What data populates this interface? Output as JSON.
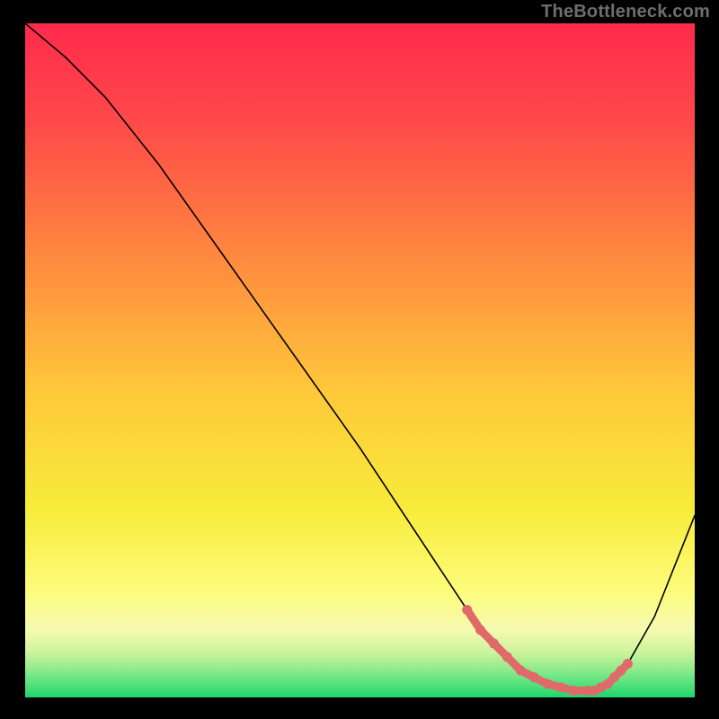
{
  "watermark": "TheBottleneck.com",
  "chart_data": {
    "type": "line",
    "title": "",
    "xlabel": "",
    "ylabel": "",
    "xlim": [
      0,
      100
    ],
    "ylim": [
      0,
      100
    ],
    "grid": false,
    "series": [
      {
        "name": "bottleneck-curve",
        "x": [
          0,
          6,
          12,
          20,
          30,
          40,
          50,
          60,
          66,
          70,
          74,
          78,
          82,
          85,
          87,
          90,
          94,
          100
        ],
        "y": [
          100,
          95,
          89,
          79,
          65,
          51,
          37,
          22,
          13,
          8,
          4,
          2,
          1,
          1,
          2,
          5,
          12,
          27
        ],
        "stroke": "#000000",
        "stroke_width": 1.6
      },
      {
        "name": "optimal-region-markers",
        "x": [
          66,
          68,
          70,
          72,
          74,
          76,
          78,
          80,
          82,
          84,
          85,
          86,
          87,
          88,
          89,
          90
        ],
        "y": [
          13,
          10,
          8,
          6,
          4,
          3,
          2,
          1.5,
          1,
          1,
          1,
          1.5,
          2,
          3,
          4,
          5
        ],
        "stroke": "#e06a6a",
        "marker_color": "#e06a6a",
        "marker_radius": 5.5
      }
    ],
    "background_gradient": {
      "stops": [
        {
          "offset": 0.0,
          "color": "#ff2a4d"
        },
        {
          "offset": 0.15,
          "color": "#ff4a49"
        },
        {
          "offset": 0.35,
          "color": "#ff8a3f"
        },
        {
          "offset": 0.55,
          "color": "#ffc93a"
        },
        {
          "offset": 0.72,
          "color": "#f7ec3a"
        },
        {
          "offset": 0.84,
          "color": "#fdfc7a"
        },
        {
          "offset": 0.9,
          "color": "#f6fab0"
        },
        {
          "offset": 0.935,
          "color": "#c9f39a"
        },
        {
          "offset": 0.965,
          "color": "#7de989"
        },
        {
          "offset": 1.0,
          "color": "#1fd66b"
        }
      ]
    }
  }
}
